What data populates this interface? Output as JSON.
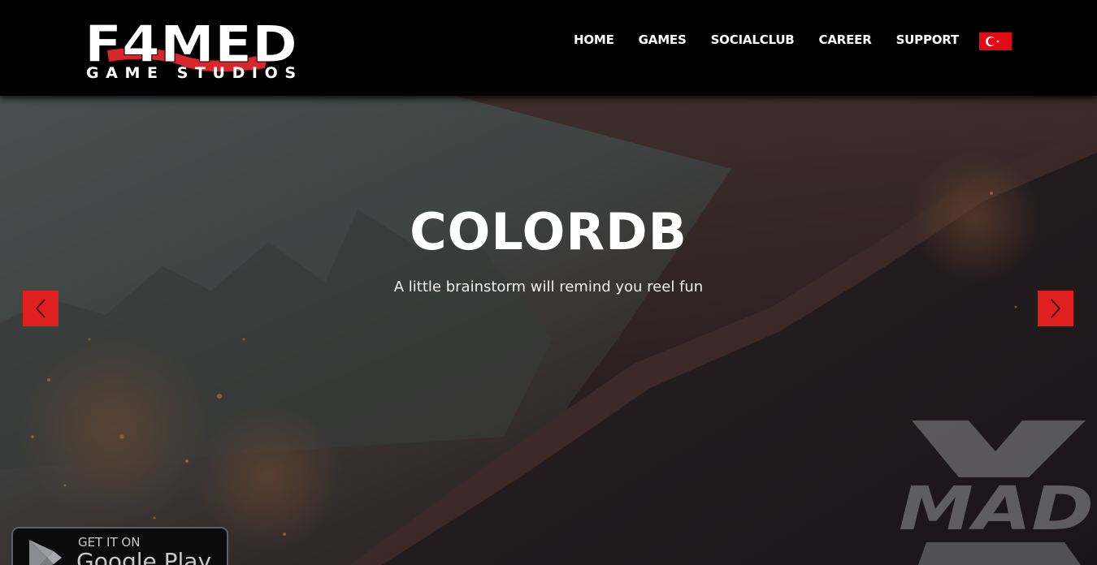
{
  "brand": {
    "logo_main": "F4MED",
    "logo_sub": "GAME STUDIOS"
  },
  "nav": {
    "items": [
      {
        "label": "HOME"
      },
      {
        "label": "GAMES"
      },
      {
        "label": "SOCIALCLUB"
      },
      {
        "label": "CAREER"
      },
      {
        "label": "SUPPORT"
      }
    ],
    "language_icon": "turkey-flag-icon"
  },
  "hero": {
    "title": "COLORDB",
    "subtitle": "A little brainstorm will remind you reel fun",
    "prev_icon": "chevron-left-icon",
    "next_icon": "chevron-right-icon"
  },
  "store_badge": {
    "small": "GET IT ON",
    "big": "Google Play",
    "icon": "google-play-icon"
  },
  "watermark": {
    "text": "MAD",
    "mark": "X"
  },
  "colors": {
    "accent": "#e01f1f",
    "header_bg": "#000000",
    "text": "#ffffff"
  }
}
